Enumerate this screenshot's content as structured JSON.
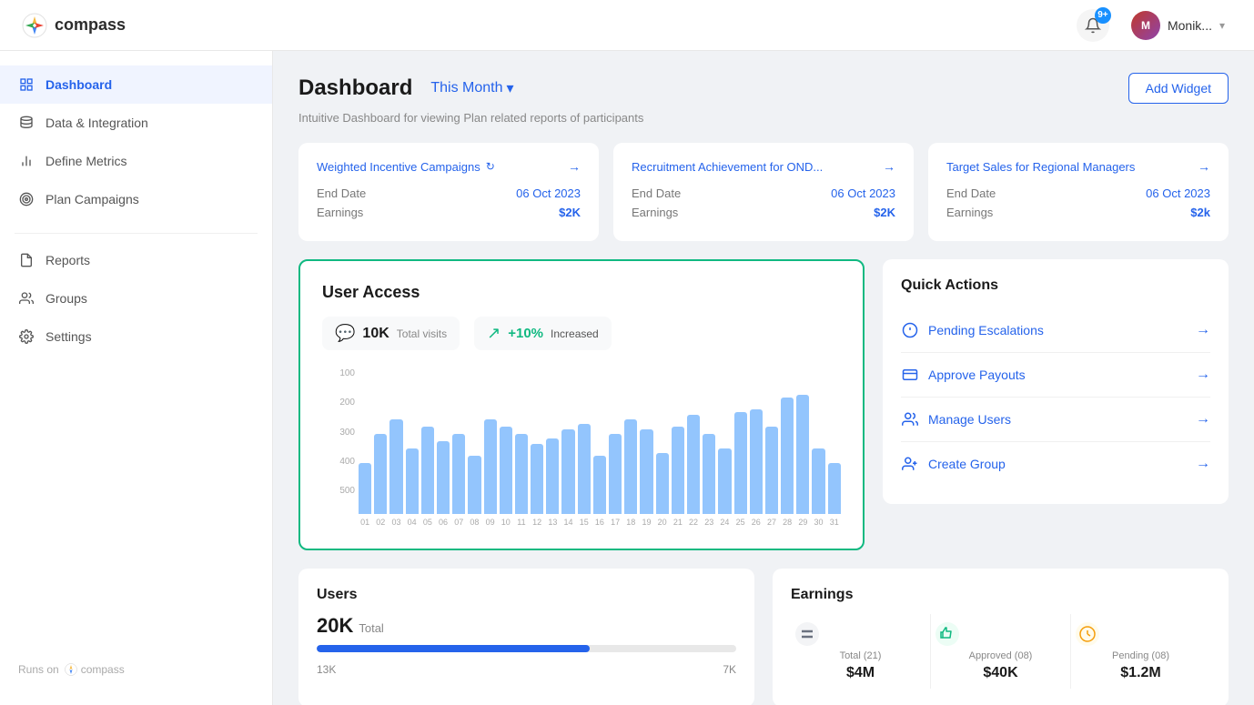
{
  "navbar": {
    "logo_text": "compass",
    "notif_badge": "9+",
    "user_name": "Monik...",
    "user_initials": "M"
  },
  "sidebar": {
    "main_items": [
      {
        "id": "dashboard",
        "label": "Dashboard",
        "icon": "grid",
        "active": true
      },
      {
        "id": "data-integration",
        "label": "Data & Integration",
        "icon": "database",
        "active": false
      },
      {
        "id": "define-metrics",
        "label": "Define Metrics",
        "icon": "chart",
        "active": false
      },
      {
        "id": "plan-campaigns",
        "label": "Plan Campaigns",
        "icon": "target",
        "active": false
      }
    ],
    "secondary_items": [
      {
        "id": "reports",
        "label": "Reports",
        "icon": "file",
        "active": false
      },
      {
        "id": "groups",
        "label": "Groups",
        "icon": "users",
        "active": false
      },
      {
        "id": "settings",
        "label": "Settings",
        "icon": "gear",
        "active": false
      }
    ],
    "footer_text": "Runs on",
    "footer_brand": "compass"
  },
  "page": {
    "title": "Dashboard",
    "period": "This Month",
    "subtitle": "Intuitive Dashboard for viewing Plan related reports of participants",
    "add_widget_label": "Add Widget"
  },
  "campaigns": [
    {
      "title": "Weighted Incentive Campaigns",
      "end_date_label": "End Date",
      "end_date": "06 Oct 2023",
      "earnings_label": "Earnings",
      "earnings": "$2K"
    },
    {
      "title": "Recruitment Achievement for OND...",
      "end_date_label": "End Date",
      "end_date": "06 Oct 2023",
      "earnings_label": "Earnings",
      "earnings": "$2K"
    },
    {
      "title": "Target Sales for Regional Managers",
      "end_date_label": "End Date",
      "end_date": "06 Oct 2023",
      "earnings_label": "Earnings",
      "earnings": "$2k"
    }
  ],
  "user_access": {
    "title": "User Access",
    "total_visits_value": "10K",
    "total_visits_label": "Total visits",
    "increase_value": "+10%",
    "increase_label": "Increased",
    "y_labels": [
      "500",
      "400",
      "300",
      "200",
      "100"
    ],
    "bar_data": [
      35,
      55,
      65,
      45,
      60,
      50,
      55,
      40,
      65,
      60,
      55,
      48,
      52,
      58,
      62,
      40,
      55,
      65,
      58,
      42,
      60,
      68,
      55,
      45,
      70,
      72,
      60,
      80,
      82,
      45,
      35
    ],
    "x_labels": [
      "01",
      "02",
      "03",
      "04",
      "05",
      "06",
      "07",
      "08",
      "09",
      "10",
      "11",
      "12",
      "13",
      "14",
      "15",
      "16",
      "17",
      "18",
      "19",
      "20",
      "21",
      "22",
      "23",
      "24",
      "25",
      "26",
      "27",
      "28",
      "29",
      "30",
      "31"
    ]
  },
  "quick_actions": {
    "title": "Quick Actions",
    "items": [
      {
        "id": "pending-escalations",
        "label": "Pending Escalations",
        "icon": "escalation"
      },
      {
        "id": "approve-payouts",
        "label": "Approve Payouts",
        "icon": "payout"
      },
      {
        "id": "manage-users",
        "label": "Manage Users",
        "icon": "manage-users"
      },
      {
        "id": "create-group",
        "label": "Create Group",
        "icon": "create-group"
      }
    ]
  },
  "users_widget": {
    "title": "Users",
    "total_value": "20K",
    "total_label": "Total",
    "bar_fill_percent": 65,
    "bottom_left_value": "13K",
    "bottom_right_value": "7K"
  },
  "earnings_widget": {
    "title": "Earnings",
    "stats": [
      {
        "id": "total",
        "label": "Total (21)",
        "value": "$4M",
        "icon": "equals",
        "icon_color": "#6b7280"
      },
      {
        "id": "approved",
        "label": "Approved (08)",
        "value": "$40K",
        "icon": "thumbsup",
        "icon_color": "#10b981"
      },
      {
        "id": "pending",
        "label": "Pending (08)",
        "value": "$1.2M",
        "icon": "clock",
        "icon_color": "#f59e0b"
      }
    ]
  }
}
